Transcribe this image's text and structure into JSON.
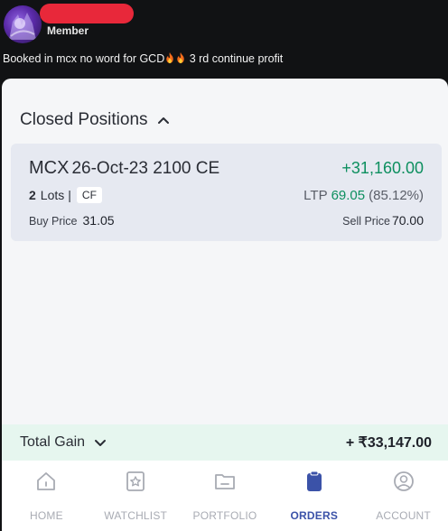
{
  "chat": {
    "role_badge": "Member",
    "message": "Booked in mcx no word for GCD",
    "message_tail": " 3 rd continue profit",
    "emoji": "fire-icon"
  },
  "app": {
    "section_title": "Closed Positions",
    "position": {
      "exchange": "MCX",
      "contract": "26-Oct-23 2100 CE",
      "pnl": "+31,160.00",
      "lots_count": "2",
      "lots_label": "Lots",
      "separator": "|",
      "product": "CF",
      "ltp_label": "LTP",
      "ltp_value": "69.05",
      "ltp_change": "(85.12%)",
      "buy_label": "Buy Price",
      "buy_value": "31.05",
      "sell_label": "Sell Price",
      "sell_value": "70.00"
    },
    "total_gain": {
      "label": "Total Gain",
      "value": "+ ₹33,147.00"
    },
    "nav": [
      {
        "label": "HOME",
        "icon": "home-icon"
      },
      {
        "label": "WATCHLIST",
        "icon": "star-icon"
      },
      {
        "label": "PORTFOLIO",
        "icon": "folder-icon"
      },
      {
        "label": "ORDERS",
        "icon": "clipboard-icon",
        "active": true
      },
      {
        "label": "ACCOUNT",
        "icon": "account-icon"
      }
    ],
    "colors": {
      "profit": "#0d8f5f",
      "active_nav": "#3b52a8",
      "gain_bar": "#e6f6ef"
    }
  }
}
